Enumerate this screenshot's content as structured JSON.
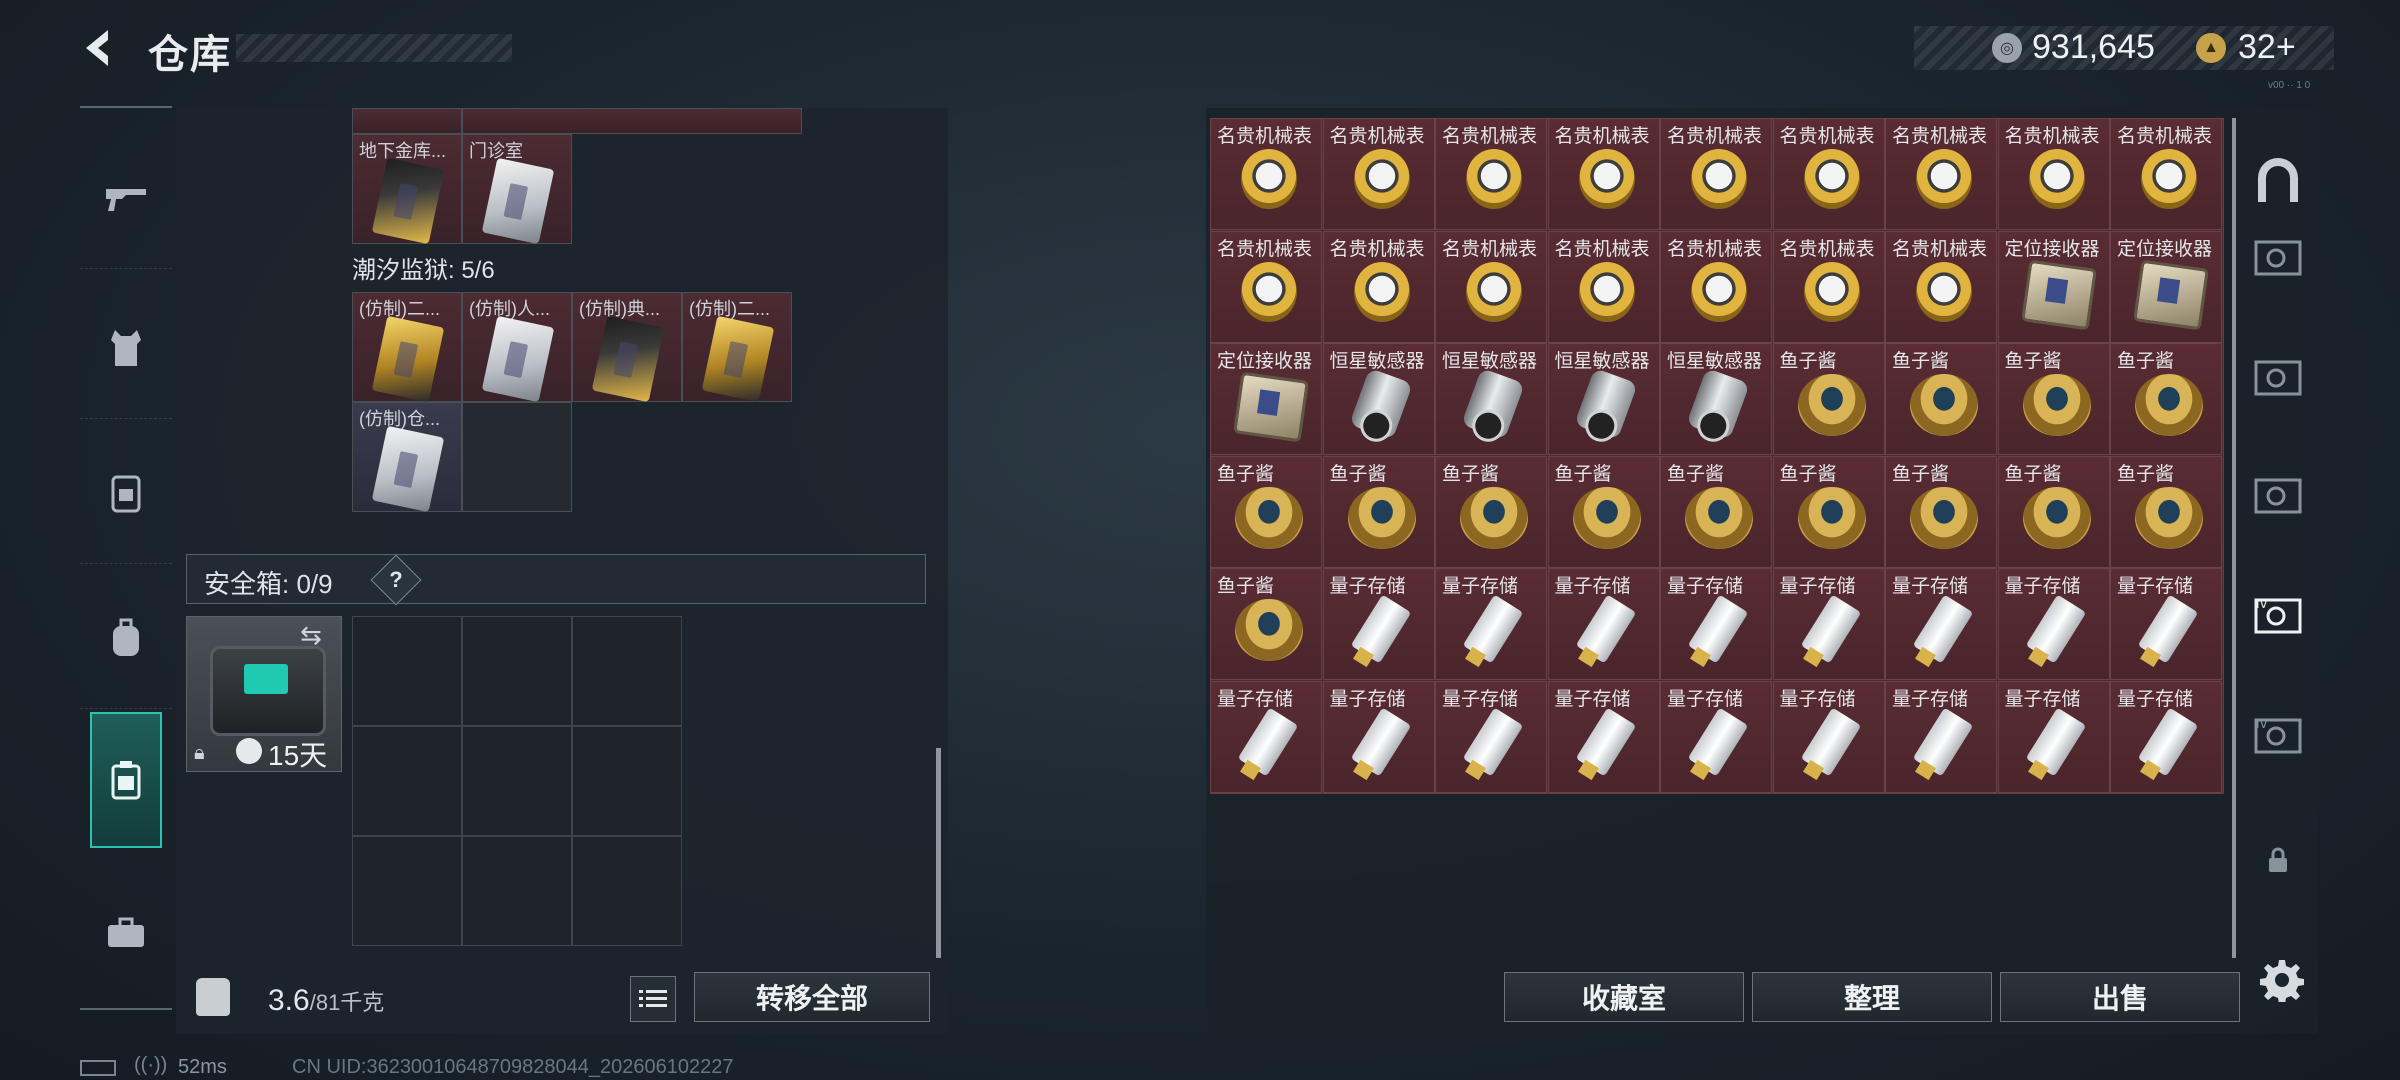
{
  "header": {
    "title": "仓库",
    "coin_value": "931,645",
    "ticket_value": "32+",
    "version_text": "v00 ·· 1 0",
    "coin_icon": "silver-coin-icon",
    "ticket_icon": "gold-ticket-icon"
  },
  "left_nav": {
    "items": [
      {
        "name": "weapon",
        "icon": "gun-icon"
      },
      {
        "name": "armor",
        "icon": "vest-icon"
      },
      {
        "name": "chest-rig",
        "icon": "rig-icon"
      },
      {
        "name": "backpack",
        "icon": "backpack-icon"
      },
      {
        "name": "container",
        "icon": "container-icon",
        "active": true
      },
      {
        "name": "case",
        "icon": "briefcase-icon"
      }
    ]
  },
  "left_panel": {
    "top_cards": [
      {
        "label": "地下金库...",
        "style": "gold2"
      },
      {
        "label": "门诊室",
        "style": "silver"
      }
    ],
    "section_title": "潮汐监狱: 5/6",
    "section_cards": [
      {
        "label": "(仿制)二...",
        "style": "gold"
      },
      {
        "label": "(仿制)人...",
        "style": "silver"
      },
      {
        "label": "(仿制)典...",
        "style": "gold"
      },
      {
        "label": "(仿制)二...",
        "style": "gold"
      },
      {
        "label": "(仿制)仓...",
        "style": "silver"
      }
    ],
    "safebox_label": "安全箱: 0/9",
    "safebox_help": "?",
    "safebox_timer": "15天",
    "weight_value": "3.6",
    "weight_capacity": "/81千克",
    "transfer_all": "转移全部"
  },
  "status": {
    "ping": "52ms",
    "uid": "CN UID:36230010648709828044_202606102227"
  },
  "right_panel": {
    "items": [
      {
        "label": "名贵机械表",
        "type": "watch"
      },
      {
        "label": "名贵机械表",
        "type": "watch"
      },
      {
        "label": "名贵机械表",
        "type": "watch"
      },
      {
        "label": "名贵机械表",
        "type": "watch"
      },
      {
        "label": "名贵机械表",
        "type": "watch"
      },
      {
        "label": "名贵机械表",
        "type": "watch"
      },
      {
        "label": "名贵机械表",
        "type": "watch"
      },
      {
        "label": "名贵机械表",
        "type": "watch"
      },
      {
        "label": "名贵机械表",
        "type": "watch"
      },
      {
        "label": "名贵机械表",
        "type": "watch"
      },
      {
        "label": "名贵机械表",
        "type": "watch"
      },
      {
        "label": "名贵机械表",
        "type": "watch"
      },
      {
        "label": "名贵机械表",
        "type": "watch"
      },
      {
        "label": "名贵机械表",
        "type": "watch"
      },
      {
        "label": "名贵机械表",
        "type": "watch"
      },
      {
        "label": "名贵机械表",
        "type": "watch"
      },
      {
        "label": "定位接收器",
        "type": "receiver"
      },
      {
        "label": "定位接收器",
        "type": "receiver"
      },
      {
        "label": "定位接收器",
        "type": "receiver"
      },
      {
        "label": "恒星敏感器",
        "type": "sensor"
      },
      {
        "label": "恒星敏感器",
        "type": "sensor"
      },
      {
        "label": "恒星敏感器",
        "type": "sensor"
      },
      {
        "label": "恒星敏感器",
        "type": "sensor"
      },
      {
        "label": "鱼子酱",
        "type": "caviar"
      },
      {
        "label": "鱼子酱",
        "type": "caviar"
      },
      {
        "label": "鱼子酱",
        "type": "caviar"
      },
      {
        "label": "鱼子酱",
        "type": "caviar"
      },
      {
        "label": "鱼子酱",
        "type": "caviar"
      },
      {
        "label": "鱼子酱",
        "type": "caviar"
      },
      {
        "label": "鱼子酱",
        "type": "caviar"
      },
      {
        "label": "鱼子酱",
        "type": "caviar"
      },
      {
        "label": "鱼子酱",
        "type": "caviar"
      },
      {
        "label": "鱼子酱",
        "type": "caviar"
      },
      {
        "label": "鱼子酱",
        "type": "caviar"
      },
      {
        "label": "鱼子酱",
        "type": "caviar"
      },
      {
        "label": "鱼子酱",
        "type": "caviar"
      },
      {
        "label": "鱼子酱",
        "type": "caviar"
      },
      {
        "label": "量子存储",
        "type": "usb"
      },
      {
        "label": "量子存储",
        "type": "usb"
      },
      {
        "label": "量子存储",
        "type": "usb"
      },
      {
        "label": "量子存储",
        "type": "usb"
      },
      {
        "label": "量子存储",
        "type": "usb"
      },
      {
        "label": "量子存储",
        "type": "usb"
      },
      {
        "label": "量子存储",
        "type": "usb"
      },
      {
        "label": "量子存储",
        "type": "usb"
      },
      {
        "label": "量子存储",
        "type": "usb"
      },
      {
        "label": "量子存储",
        "type": "usb"
      },
      {
        "label": "量子存储",
        "type": "usb"
      },
      {
        "label": "量子存储",
        "type": "usb"
      },
      {
        "label": "量子存储",
        "type": "usb"
      },
      {
        "label": "量子存储",
        "type": "usb"
      },
      {
        "label": "量子存储",
        "type": "usb"
      },
      {
        "label": "量子存储",
        "type": "usb"
      },
      {
        "label": "量子存储",
        "type": "usb"
      }
    ],
    "collection_button": "收藏室",
    "sort_button": "整理",
    "sell_button": "出售"
  },
  "right_tabs": {
    "items": [
      {
        "name": "tab-home",
        "icon": "arch-icon",
        "label": ""
      },
      {
        "name": "tab-warehouse-1",
        "icon": "safe-icon",
        "label": ""
      },
      {
        "name": "tab-warehouse-2",
        "icon": "safe-icon",
        "label": ""
      },
      {
        "name": "tab-warehouse-3",
        "icon": "safe-icon",
        "label": ""
      },
      {
        "name": "tab-warehouse-4",
        "icon": "safe-icon",
        "label": "IV",
        "active": true
      },
      {
        "name": "tab-warehouse-5",
        "icon": "safe-icon",
        "label": "IV"
      },
      {
        "name": "tab-locked",
        "icon": "lock-icon",
        "label": ""
      }
    ]
  }
}
